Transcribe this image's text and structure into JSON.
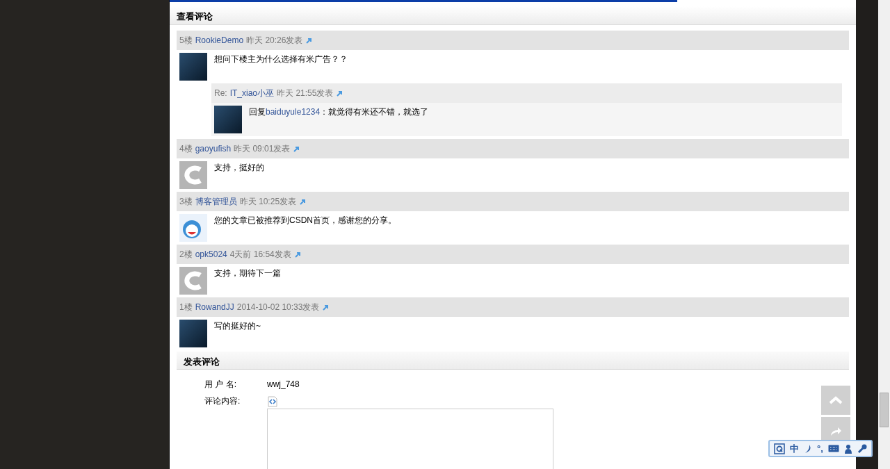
{
  "view_section": {
    "title": "查看评论"
  },
  "comments": [
    {
      "floor": "5楼",
      "user": "RookieDemo",
      "time": "昨天 20:26发表",
      "avatar": {
        "kind": "photo"
      },
      "text": "想问下楼主为什么选择有米广告？？",
      "replies": [
        {
          "prefix": "Re:",
          "user": "IT_xiao小巫",
          "time": "昨天 21:55发表",
          "avatar": {
            "kind": "photo"
          },
          "reply_word": "回复",
          "reply_to": "baiduyule1234",
          "text": "：就觉得有米还不错，就选了"
        }
      ]
    },
    {
      "floor": "4楼",
      "user": "gaoyufish",
      "time": "昨天 09:01发表",
      "avatar": {
        "kind": "logo"
      },
      "text": "支持，挺好的"
    },
    {
      "floor": "3楼",
      "user": "博客管理员",
      "time": "昨天 10:25发表",
      "avatar": {
        "kind": "cartoon"
      },
      "text": "您的文章已被推荐到CSDN首页，感谢您的分享。"
    },
    {
      "floor": "2楼",
      "user": "opk5024",
      "time": "4天前 16:54发表",
      "avatar": {
        "kind": "logo"
      },
      "text": "支持，期待下一篇"
    },
    {
      "floor": "1楼",
      "user": "RowandJJ",
      "time": "2014-10-02 10:33发表",
      "avatar": {
        "kind": "photo"
      },
      "text": "写的挺好的~"
    }
  ],
  "post_section": {
    "title": "发表评论",
    "username_label": "用 户 名:",
    "username": "wwj_748",
    "content_label": "评论内容:"
  },
  "ime_toolbar": {
    "mode": "中",
    "punctuation": "°,"
  },
  "reading_progress": {
    "level": 0.74
  }
}
